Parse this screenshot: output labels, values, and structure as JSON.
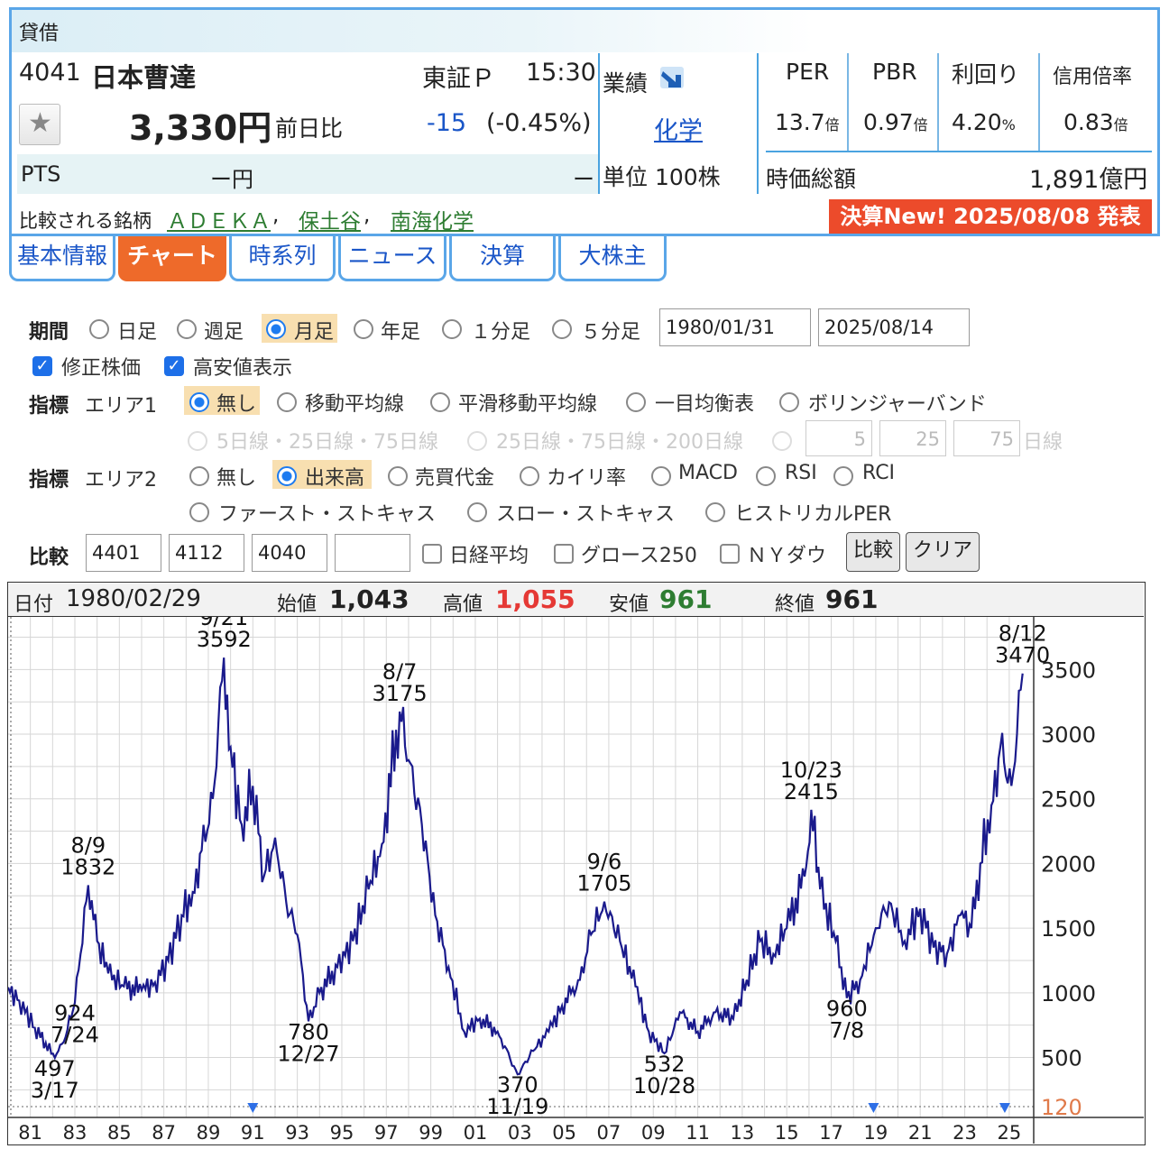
{
  "header": {
    "section_title": "貸借",
    "code": "4041",
    "name": "日本曹達",
    "market": "東証Ｐ",
    "time": "15:30",
    "price": "3,330円",
    "change_label": "前日比",
    "change": "-15",
    "change_pct": "(-0.45%)",
    "pts_label": "PTS",
    "pts_value": "ー円",
    "pts_change": "ー",
    "gyoseki_label": "業績",
    "industry": "化学",
    "unit": "単位 100株",
    "per_label": "PER",
    "per_value": "13.7",
    "per_unit": "倍",
    "pbr_label": "PBR",
    "pbr_value": "0.97",
    "pbr_unit": "倍",
    "yield_label": "利回り",
    "yield_value": "4.20",
    "yield_unit": "%",
    "margin_label": "信用倍率",
    "margin_value": "0.83",
    "margin_unit": "倍",
    "mcap_label": "時価総額",
    "mcap_value": "1,891億円",
    "compare_label": "比較される銘柄",
    "compare_links": [
      "ＡＤＥＫＡ",
      "保土谷",
      "南海化学"
    ],
    "earnings_badge": "決算New! 2025/08/08 発表"
  },
  "tabs": [
    "基本情報",
    "チャート",
    "時系列",
    "ニュース",
    "決算",
    "大株主"
  ],
  "controls": {
    "period_label": "期間",
    "period_options": [
      "日足",
      "週足",
      "月足",
      "年足",
      "１分足",
      "５分足"
    ],
    "date_from": "1980/01/31",
    "date_to": "2025/08/14",
    "adjusted": "修正株価",
    "highlow": "高安値表示",
    "indicator_label": "指標",
    "area1_label": "エリア1",
    "area1_options": [
      "無し",
      "移動平均線",
      "平滑移動平均線",
      "一目均衡表",
      "ボリンジャーバンド"
    ],
    "ma_presets": [
      "5日線・25日線・75日線",
      "25日線・75日線・200日線"
    ],
    "ma_inputs": [
      "5",
      "25",
      "75"
    ],
    "ma_unit": "日線",
    "area2_label": "エリア2",
    "area2_options": [
      "無し",
      "出来高",
      "売買代金",
      "カイリ率",
      "MACD",
      "RSI",
      "RCI"
    ],
    "area2_options_row2": [
      "ファースト・ストキャス",
      "スロー・ストキャス",
      "ヒストリカルPER"
    ],
    "compare_label": "比較",
    "compare_inputs": [
      "4401",
      "4112",
      "4040",
      ""
    ],
    "compare_checks": [
      "日経平均",
      "グロース250",
      "ＮＹダウ"
    ],
    "compare_button": "比較",
    "clear_button": "クリア"
  },
  "ohlc_bar": {
    "date_label": "日付",
    "date": "1980/02/29",
    "open_label": "始値",
    "open": "1,043",
    "high_label": "高値",
    "high": "1,055",
    "low_label": "安値",
    "low": "961",
    "close_label": "終値",
    "close": "961"
  },
  "chart_data": {
    "type": "line",
    "x_start_year": 1980,
    "x_tick_labels": [
      "81",
      "83",
      "85",
      "87",
      "89",
      "91",
      "93",
      "95",
      "97",
      "99",
      "01",
      "03",
      "05",
      "07",
      "09",
      "11",
      "13",
      "15",
      "17",
      "19",
      "21",
      "23",
      "25"
    ],
    "y_tick_labels": [
      "3500",
      "3000",
      "2500",
      "2000",
      "1500",
      "1000",
      "500",
      "120"
    ],
    "ylim": [
      120,
      3900
    ],
    "grid": true,
    "series": [
      {
        "x": [
          1980.0,
          1980.5,
          1981.2,
          1982.1,
          1982.5,
          1983.0,
          1983.6,
          1984.0,
          1984.5,
          1985.2,
          1986.0,
          1986.6,
          1987.2,
          1987.8,
          1988.3,
          1988.7,
          1989.2,
          1989.7,
          1990.0,
          1990.5,
          1991.0,
          1991.5,
          1992.0,
          1992.5,
          1993.0,
          1993.5,
          1994.0,
          1994.8,
          1995.5,
          1996.2,
          1996.8,
          1997.6,
          1998.0,
          1998.6,
          1999.2,
          1999.8,
          2000.5,
          2001.2,
          2002.0,
          2002.9,
          2003.6,
          2004.3,
          2004.9,
          2005.7,
          2006.2,
          2006.8,
          2007.5,
          2008.2,
          2008.8,
          2009.5,
          2010.2,
          2011.0,
          2011.8,
          2012.6,
          2013.2,
          2013.8,
          2014.4,
          2015.0,
          2015.8,
          2016.1,
          2016.5,
          2017.2,
          2017.7,
          2018.3,
          2019.0,
          2019.6,
          2020.3,
          2021.0,
          2021.6,
          2022.2,
          2022.8,
          2023.3,
          2023.7,
          2024.2,
          2024.6,
          2025.1,
          2025.6
        ],
        "y": [
          1043,
          940,
          730,
          497,
          620,
          924,
          1832,
          1400,
          1150,
          1050,
          1020,
          1080,
          1250,
          1600,
          1780,
          2100,
          2500,
          3592,
          2900,
          2300,
          2600,
          1900,
          2200,
          1700,
          1450,
          780,
          1000,
          1200,
          1400,
          1800,
          2150,
          3175,
          2800,
          2300,
          1600,
          1200,
          700,
          800,
          700,
          370,
          550,
          700,
          900,
          1100,
          1450,
          1705,
          1400,
          1050,
          700,
          532,
          850,
          700,
          850,
          800,
          1100,
          1400,
          1300,
          1500,
          1900,
          2415,
          1800,
          1400,
          960,
          1100,
          1500,
          1700,
          1400,
          1650,
          1350,
          1300,
          1600,
          1500,
          2000,
          2450,
          2900,
          2600,
          3470
        ]
      }
    ],
    "annotations": [
      {
        "x": 1982.1,
        "y": 497,
        "date": "3/17",
        "value": "497",
        "pos": "below"
      },
      {
        "x": 1983.0,
        "y": 924,
        "date": "7/24",
        "value": "924",
        "pos": "below"
      },
      {
        "x": 1983.6,
        "y": 1832,
        "date": "8/9",
        "value": "1832",
        "pos": "above"
      },
      {
        "x": 1989.7,
        "y": 3592,
        "date": "9/21",
        "value": "3592",
        "pos": "above"
      },
      {
        "x": 1993.5,
        "y": 780,
        "date": "12/27",
        "value": "780",
        "pos": "below"
      },
      {
        "x": 1997.6,
        "y": 3175,
        "date": "8/7",
        "value": "3175",
        "pos": "above"
      },
      {
        "x": 2002.9,
        "y": 370,
        "date": "11/19",
        "value": "370",
        "pos": "below"
      },
      {
        "x": 2006.8,
        "y": 1705,
        "date": "9/6",
        "value": "1705",
        "pos": "above"
      },
      {
        "x": 2009.5,
        "y": 532,
        "date": "10/28",
        "value": "532",
        "pos": "below"
      },
      {
        "x": 2016.1,
        "y": 2415,
        "date": "10/23",
        "value": "2415",
        "pos": "above"
      },
      {
        "x": 2017.7,
        "y": 960,
        "date": "7/8",
        "value": "960",
        "pos": "below"
      },
      {
        "x": 2025.6,
        "y": 3470,
        "date": "8/12",
        "value": "3470",
        "pos": "above"
      }
    ],
    "event_markers_x": [
      1991.0,
      2018.9,
      2024.8
    ]
  }
}
